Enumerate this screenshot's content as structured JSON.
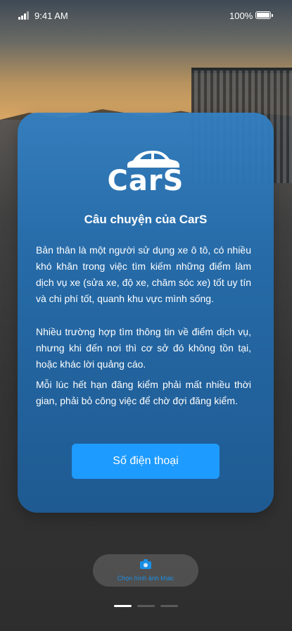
{
  "status_bar": {
    "time": "9:41 AM",
    "battery": "100%"
  },
  "card": {
    "logo_text": "CarS",
    "title": "Câu chuyện của CarS",
    "paragraphs": [
      "Bản thân là một người sử dụng xe ô tô, có nhiều khó khăn trong việc tìm kiếm những điểm làm dịch vụ xe (sửa xe, độ xe, chăm sóc xe) tốt uy tín và chi phí tốt, quanh khu vực mình sống.",
      "Nhiều trường hợp tìm thông tin về điểm dịch vụ, nhưng khi đến nơi thì cơ sở đó không tồn tại, hoặc khác lời quảng cáo.",
      "Mỗi lúc hết hạn đăng kiểm phải mất nhiều thời gian, phải bỏ công việc để chờ đợi đăng kiểm."
    ],
    "phone_button": "Số điện thoại"
  },
  "change_image": {
    "label": "Chọn hình ảnh khác",
    "icon": "camera-icon",
    "color": "#1b8fe6"
  },
  "pager": {
    "pages": 3,
    "active": 1
  },
  "colors": {
    "accent": "#1e9bff",
    "card": "#2b74b6"
  }
}
